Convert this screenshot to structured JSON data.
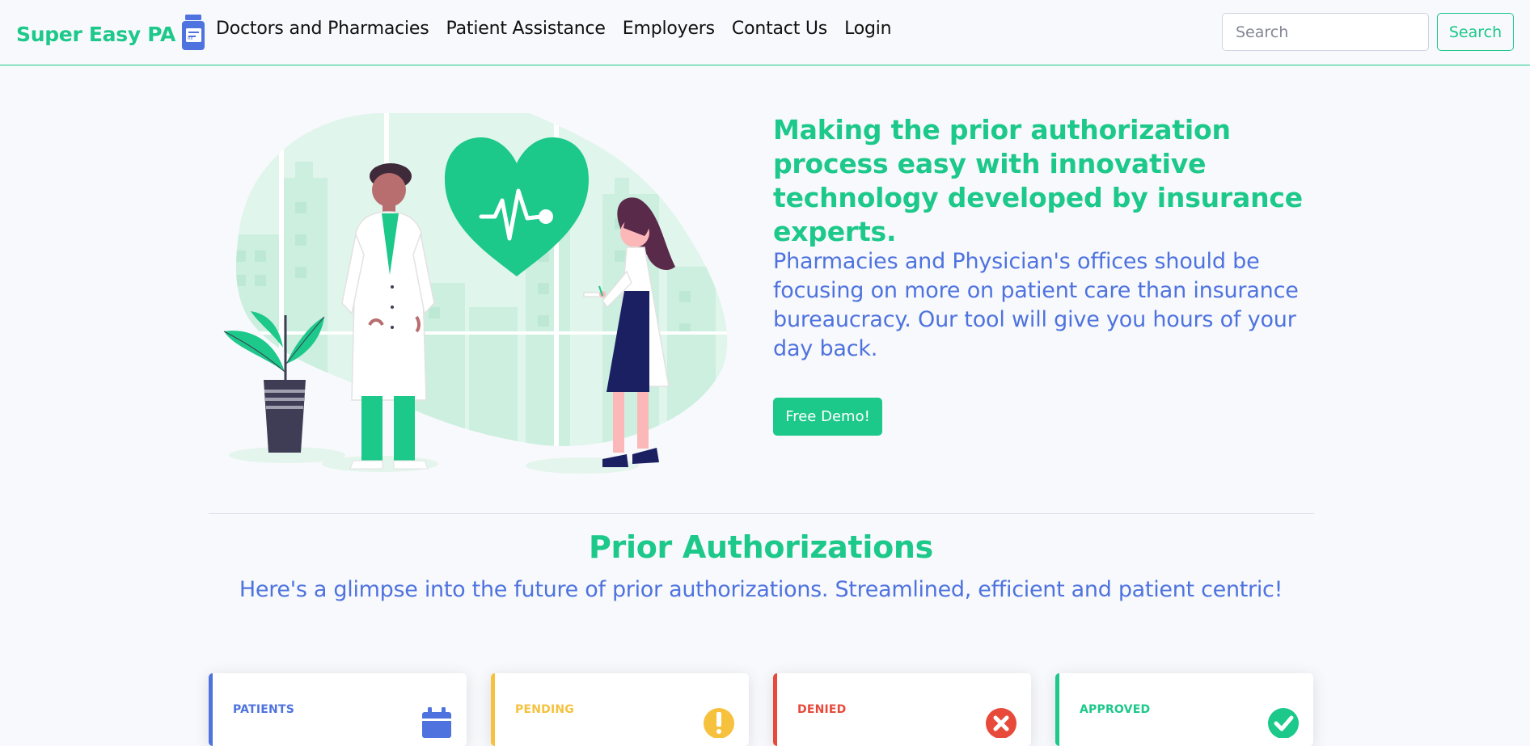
{
  "navbar": {
    "brand": "Super Easy PA",
    "brand_icon": "pill-bottle-icon",
    "links": [
      {
        "label": "Doctors and Pharmacies"
      },
      {
        "label": "Patient Assistance"
      },
      {
        "label": "Employers"
      },
      {
        "label": "Contact Us"
      },
      {
        "label": "Login"
      }
    ],
    "search": {
      "placeholder": "Search",
      "value": ""
    },
    "search_button": "Search"
  },
  "hero": {
    "headline": "Making the prior authorization process easy with innovative technology developed by insurance experts.",
    "subtext": "Pharmacies and Physician's offices should be focusing on more on patient care than insurance bureaucracy. Our tool will give you hours of your day back.",
    "cta_label": "Free Demo!",
    "illustration": "doctors-heart-illustration"
  },
  "section": {
    "title": "Prior Authorizations",
    "subtitle": "Here's a glimpse into the future of prior authorizations. Streamlined, efficient and patient centric!"
  },
  "cards": [
    {
      "label": "Patients",
      "color": "#4e73df",
      "icon": "calendar-icon"
    },
    {
      "label": "Pending",
      "color": "#f6c23e",
      "icon": "exclamation-icon"
    },
    {
      "label": "Denied",
      "color": "#e74a3b",
      "icon": "times-circle-icon"
    },
    {
      "label": "Approved",
      "color": "#1cc88a",
      "icon": "check-circle-icon"
    }
  ],
  "colors": {
    "primary_green": "#1cc88a",
    "primary_blue": "#4e73df",
    "warning": "#f6c23e",
    "danger": "#e74a3b",
    "background": "#f8f9fc"
  }
}
